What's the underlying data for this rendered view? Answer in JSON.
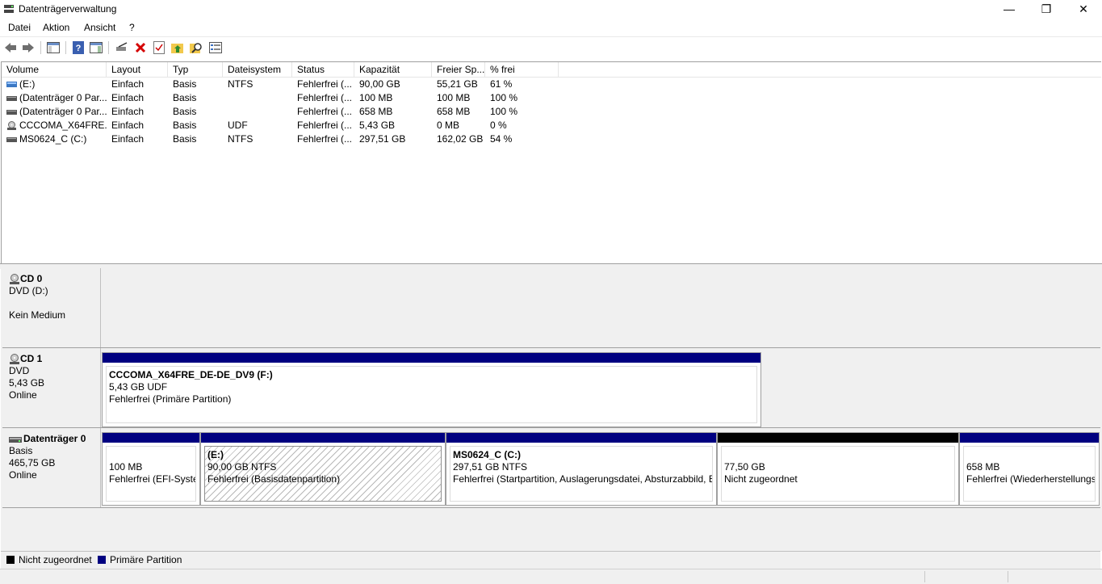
{
  "window": {
    "title": "Datenträgerverwaltung",
    "minimize": "—",
    "maximize": "❐",
    "close": "✕"
  },
  "menu": [
    "Datei",
    "Aktion",
    "Ansicht",
    "?"
  ],
  "toolbar": {
    "icons": [
      "back-icon",
      "forward-icon",
      "console-tree-icon",
      "help-icon",
      "action-pane-icon",
      "connect-disk-icon",
      "delete-icon",
      "check-disk-icon",
      "up-folder-icon",
      "search-icon",
      "properties-icon"
    ]
  },
  "volume_list": {
    "columns": [
      "Volume",
      "Layout",
      "Typ",
      "Dateisystem",
      "Status",
      "Kapazität",
      "Freier Sp...",
      "% frei"
    ],
    "rows": [
      {
        "icon": "partition-icon",
        "volume": "(E:)",
        "layout": "Einfach",
        "typ": "Basis",
        "fs": "NTFS",
        "status": "Fehlerfrei (...",
        "capacity": "90,00 GB",
        "free": "55,21 GB",
        "pct": "61 %"
      },
      {
        "icon": "disk-icon",
        "volume": "(Datenträger 0 Par...",
        "layout": "Einfach",
        "typ": "Basis",
        "fs": "",
        "status": "Fehlerfrei (...",
        "capacity": "100 MB",
        "free": "100 MB",
        "pct": "100 %"
      },
      {
        "icon": "disk-icon",
        "volume": "(Datenträger 0 Par...",
        "layout": "Einfach",
        "typ": "Basis",
        "fs": "",
        "status": "Fehlerfrei (...",
        "capacity": "658 MB",
        "free": "658 MB",
        "pct": "100 %"
      },
      {
        "icon": "cd-icon",
        "volume": "CCCOMA_X64FRE...",
        "layout": "Einfach",
        "typ": "Basis",
        "fs": "UDF",
        "status": "Fehlerfrei (...",
        "capacity": "5,43 GB",
        "free": "0 MB",
        "pct": "0 %"
      },
      {
        "icon": "disk-icon",
        "volume": "MS0624_C (C:)",
        "layout": "Einfach",
        "typ": "Basis",
        "fs": "NTFS",
        "status": "Fehlerfrei (...",
        "capacity": "297,51 GB",
        "free": "162,02 GB",
        "pct": "54 %"
      }
    ]
  },
  "disks": {
    "cd0": {
      "name": "CD 0",
      "type": "DVD (D:)",
      "size": "",
      "state": "Kein Medium"
    },
    "cd1": {
      "name": "CD 1",
      "type": "DVD",
      "size": "5,43 GB",
      "state": "Online",
      "partition": {
        "title": "CCCOMA_X64FRE_DE-DE_DV9  (F:)",
        "line1": "5,43 GB UDF",
        "line2": "Fehlerfrei (Primäre Partition)"
      }
    },
    "disk0": {
      "name": "Datenträger 0",
      "type": "Basis",
      "size": "465,75 GB",
      "state": "Online",
      "partitions": [
        {
          "title": "",
          "line1": "100 MB",
          "line2": "Fehlerfrei (EFI-Systempartition)"
        },
        {
          "title": "(E:)",
          "line1": "90,00 GB NTFS",
          "line2": "Fehlerfrei (Basisdatenpartition)"
        },
        {
          "title": "MS0624_C  (C:)",
          "line1": "297,51 GB NTFS",
          "line2": "Fehlerfrei (Startpartition, Auslagerungsdatei, Absturzabbild, Basisdatenpartition)"
        },
        {
          "title": "",
          "line1": "77,50 GB",
          "line2": "Nicht zugeordnet"
        },
        {
          "title": "",
          "line1": "658 MB",
          "line2": "Fehlerfrei (Wiederherstellungspartition)"
        }
      ]
    }
  },
  "legend": {
    "unallocated": "Nicht zugeordnet",
    "primary": "Primäre Partition"
  },
  "colors": {
    "primary": "#000080",
    "unallocated": "#000000"
  }
}
